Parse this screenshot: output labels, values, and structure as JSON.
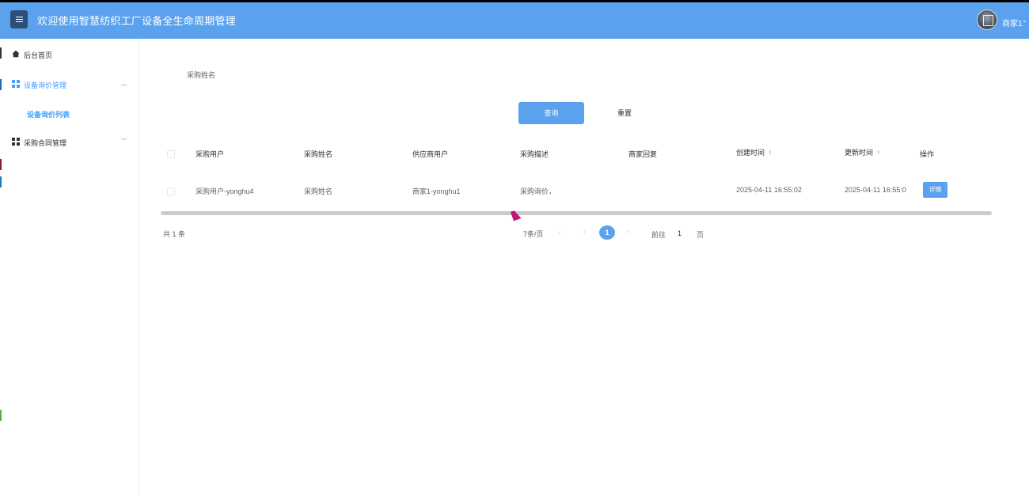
{
  "header": {
    "title": "欢迎使用智慧纺织工厂设备全生命周期管理",
    "user_name": "商家1",
    "menu_icon": "hamburger-icon",
    "avatar_icon": "avatar-icon",
    "caret_icon": "chevron-down-icon"
  },
  "sidebar": {
    "items": [
      {
        "label": "后台首页",
        "icon": "home-icon"
      },
      {
        "label": "设备询价管理",
        "icon": "grid-icon",
        "expanded": true
      },
      {
        "label": "采购合同管理",
        "icon": "grid-icon",
        "expanded": false
      }
    ],
    "sub_items": [
      {
        "label": "设备询价列表",
        "active": true
      }
    ]
  },
  "filter": {
    "label": "采购姓名",
    "query_label": "查询",
    "reset_label": "重置"
  },
  "table": {
    "columns": [
      "采购用户",
      "采购姓名",
      "供应商用户",
      "采购描述",
      "商家回复",
      "创建时间",
      "更新时间",
      "操作"
    ],
    "rows": [
      {
        "purchase_user": "采购用户-yonghu4",
        "purchase_name": "采购姓名",
        "supplier_user": "商家1-yonghu1",
        "description": "采购询价，",
        "reply": "",
        "created": "2025-04-11 16:55:02",
        "updated": "2025-04-11 16:55:0",
        "action_label": "详情"
      }
    ]
  },
  "pagination": {
    "total": "共 1 条",
    "page_size": "7条/页",
    "current_page": "1",
    "goto_label": "前往",
    "goto_value": "1",
    "page_unit": "页"
  },
  "colors": {
    "header_bg": "#5aa2ee",
    "primary": "#409eff",
    "menu_btn": "#2e4e78"
  }
}
